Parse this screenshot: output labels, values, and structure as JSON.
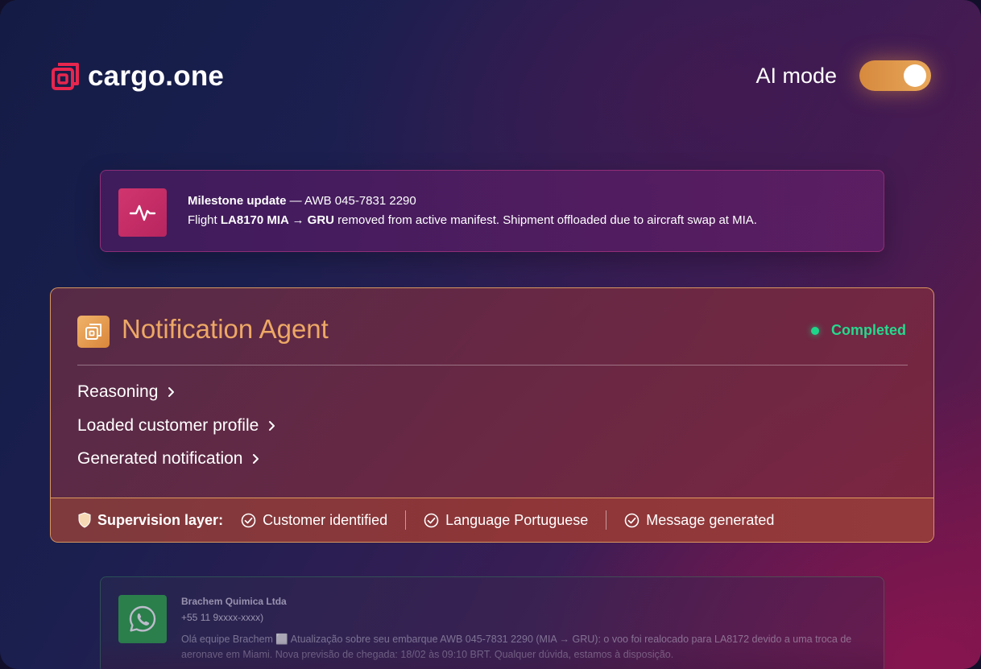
{
  "header": {
    "logo_text": "cargo.one",
    "logo_icon": "cargo-one-logo-icon",
    "ai_mode_label": "AI mode",
    "ai_mode_on": true
  },
  "milestone": {
    "icon": "pulse-icon",
    "title": "Milestone update",
    "separator": " — ",
    "awb": "AWB 045-7831 2290",
    "line2_prefix": "Flight ",
    "flight": "LA8170 MIA → GRU",
    "line2_suffix": " removed from active manifest. Shipment offloaded due to aircraft swap at MIA."
  },
  "agent": {
    "icon": "agent-icon",
    "title": "Notification Agent",
    "status": "Completed",
    "rows": [
      {
        "label": "Reasoning"
      },
      {
        "label": "Loaded customer profile"
      },
      {
        "label": "Generated notification"
      }
    ],
    "supervision": {
      "label": "Supervision layer:",
      "items": [
        "Customer identified",
        "Language Portuguese",
        "Message generated"
      ]
    }
  },
  "whatsapp": {
    "icon": "whatsapp-icon",
    "name": "Brachem Quimica Ltda",
    "phone": "+55 11 9xxxx-xxxx)",
    "message": "Olá equipe Brachem ⬜ Atualização sobre seu embarque AWB 045-7831 2290 (MIA → GRU): o voo foi realocado para LA8172 devido a uma troca de aeronave em Miami. Nova previsão de chegada: 18/02 às 09:10 BRT. Qualquer dúvida, estamos à disposição."
  },
  "colors": {
    "accent_orange": "#eda865",
    "status_green": "#25d98e",
    "brand_red": "#e8264e",
    "milestone_pink": "#d1356e",
    "whatsapp_green": "#2fa84a"
  }
}
